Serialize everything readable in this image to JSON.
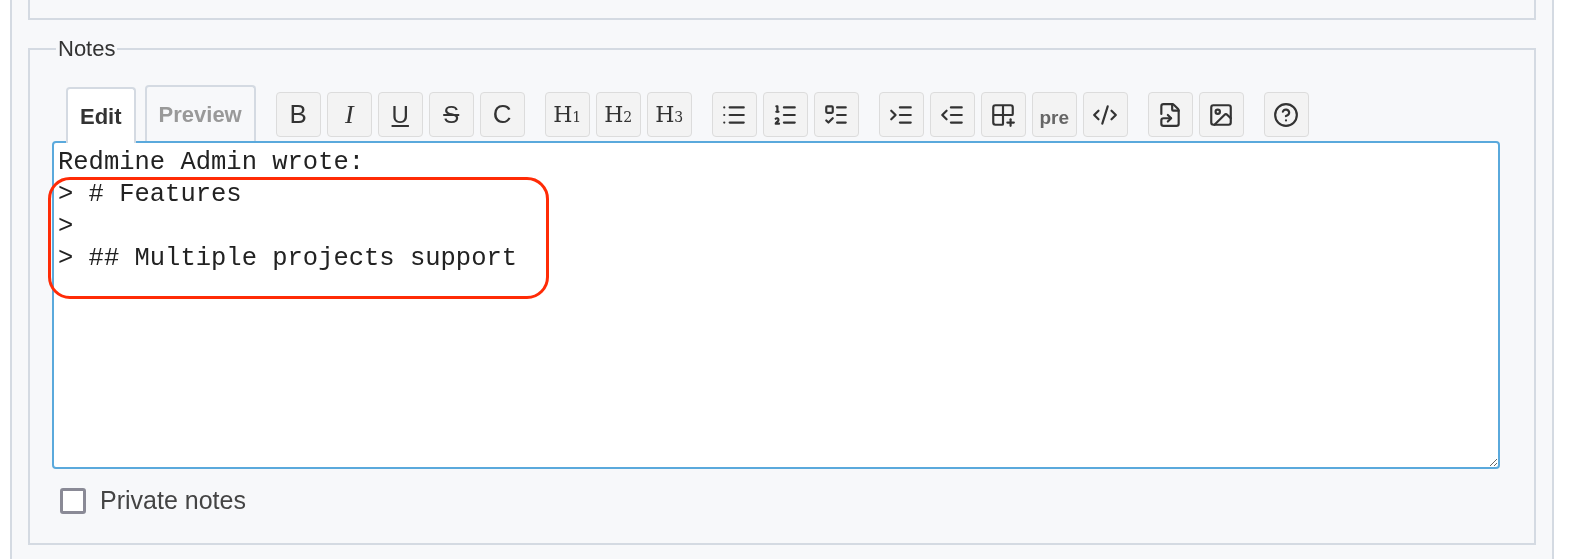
{
  "notes": {
    "legend": "Notes",
    "tabs": [
      {
        "label": "Edit",
        "selected": true
      },
      {
        "label": "Preview",
        "selected": false
      }
    ],
    "toolbar": [
      {
        "buttons": [
          {
            "kind": "bold",
            "label": "B"
          },
          {
            "kind": "italic",
            "label": "I"
          },
          {
            "kind": "underline",
            "label": "U"
          },
          {
            "kind": "strike",
            "label": "S"
          },
          {
            "kind": "letter",
            "label": "C"
          }
        ]
      },
      {
        "buttons": [
          {
            "kind": "heading",
            "label": "H",
            "sub": "1"
          },
          {
            "kind": "heading",
            "label": "H",
            "sub": "2"
          },
          {
            "kind": "heading",
            "label": "H",
            "sub": "3"
          }
        ]
      },
      {
        "buttons": [
          {
            "kind": "bulleted"
          },
          {
            "kind": "numbered"
          },
          {
            "kind": "tasks"
          }
        ]
      },
      {
        "buttons": [
          {
            "kind": "indent"
          },
          {
            "kind": "outdent"
          },
          {
            "kind": "table"
          },
          {
            "kind": "pre",
            "label": "pre"
          },
          {
            "kind": "code"
          }
        ]
      },
      {
        "buttons": [
          {
            "kind": "attachment"
          },
          {
            "kind": "image"
          }
        ]
      },
      {
        "buttons": [
          {
            "kind": "help"
          }
        ]
      }
    ],
    "text": "Redmine Admin wrote:\n> # Features\n>\n> ## Multiple projects support",
    "highlight": true,
    "private_notes": {
      "label": "Private notes",
      "checked": false
    }
  }
}
